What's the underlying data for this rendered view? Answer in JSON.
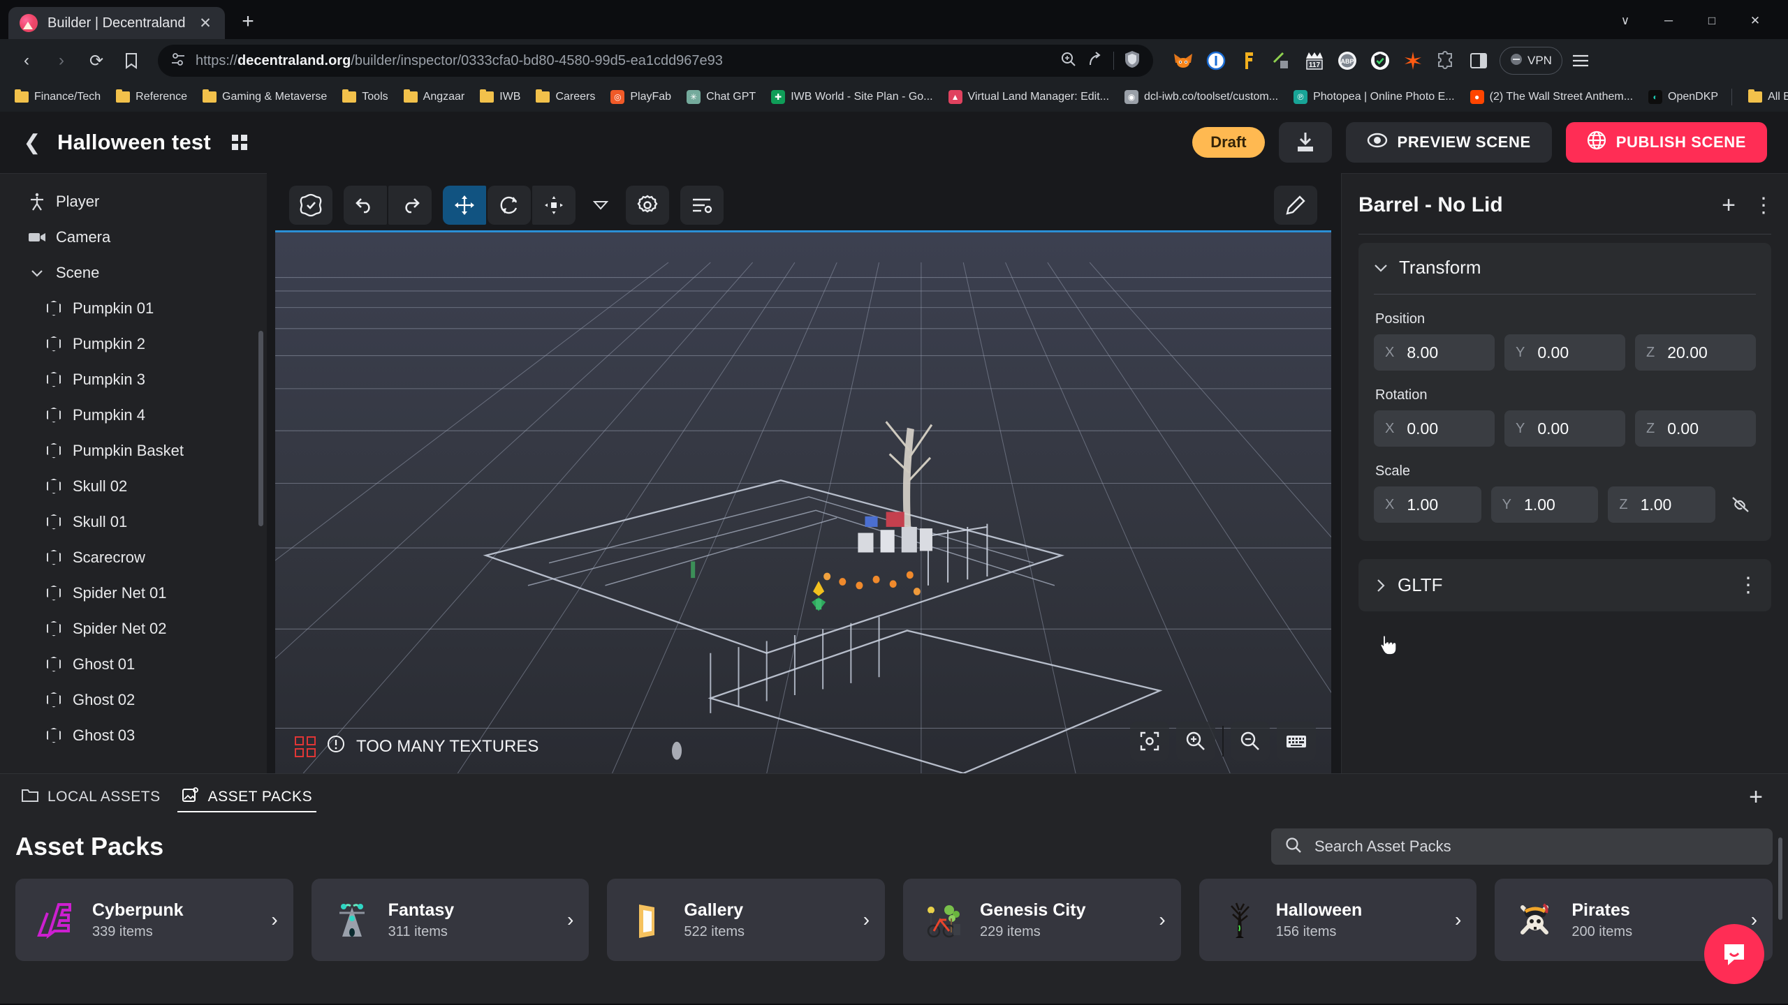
{
  "browser": {
    "tab": {
      "title": "Builder | Decentraland",
      "favicon": "decentraland-favicon",
      "close": "✕"
    },
    "newtab_label": "+",
    "window_controls": [
      "∨",
      "─",
      "□",
      "✕"
    ],
    "nav": {
      "back": "‹",
      "forward": "›",
      "reload": "⟳",
      "bookmark_star": "bookmark-icon"
    },
    "url": {
      "scheme": "https://",
      "domain": "decentraland.org",
      "path": "/builder/inspector/0333cfa0-bd80-4580-99d5-ea1cdd967e93",
      "full": "https://decentraland.org/builder/inspector/0333cfa0-bd80-4580-99d5-ea1cdd967e93"
    },
    "vpn_label": "VPN",
    "extensions": [
      {
        "name": "metamask-extension",
        "glyph": "🦊"
      },
      {
        "name": "1password-extension",
        "glyph": "①"
      },
      {
        "name": "yellow-tool-extension",
        "glyph": "🔨"
      },
      {
        "name": "eyedropper-extension",
        "glyph": "✒"
      },
      {
        "name": "badge-117-extension",
        "glyph": "117"
      },
      {
        "name": "adblock-plus-extension",
        "glyph": "ABP"
      },
      {
        "name": "shield-extension",
        "glyph": "✓"
      },
      {
        "name": "star-extension",
        "glyph": "✳"
      },
      {
        "name": "puzzle-extensions-icon",
        "glyph": "❖"
      },
      {
        "name": "side-panel-icon",
        "glyph": "◯"
      },
      {
        "name": "browser-menu-icon",
        "glyph": "☰"
      }
    ],
    "bookmarks": [
      {
        "label": "Finance/Tech",
        "type": "folder"
      },
      {
        "label": "Reference",
        "type": "folder"
      },
      {
        "label": "Gaming & Metaverse",
        "type": "folder"
      },
      {
        "label": "Tools",
        "type": "folder"
      },
      {
        "label": "Angzaar",
        "type": "folder"
      },
      {
        "label": "IWB",
        "type": "folder"
      },
      {
        "label": "Careers",
        "type": "folder"
      },
      {
        "label": "PlayFab",
        "type": "site",
        "color": "#f05a28",
        "glyph": "◎"
      },
      {
        "label": "Chat GPT",
        "type": "site",
        "color": "#74aa9c",
        "glyph": "✳"
      },
      {
        "label": "IWB World - Site Plan - Go...",
        "type": "site",
        "color": "#0f9d58",
        "glyph": "✚"
      },
      {
        "label": "Virtual Land Manager: Edit...",
        "type": "site",
        "color": "#e0425f",
        "glyph": "▲"
      },
      {
        "label": "dcl-iwb.co/toolset/custom...",
        "type": "site",
        "color": "#9aa0a8",
        "glyph": "◉"
      },
      {
        "label": "Photopea | Online Photo E...",
        "type": "site",
        "color": "#18a497",
        "glyph": "℗"
      },
      {
        "label": "(2) The Wall Street Anthem...",
        "type": "site",
        "color": "#ff4500",
        "glyph": "●"
      },
      {
        "label": "OpenDKP",
        "type": "site",
        "color": "#1cc8b0",
        "glyph": "◐"
      }
    ],
    "all_bookmarks_label": "All Bookmarks"
  },
  "app_header": {
    "back_icon": "back-chevron-icon",
    "scene_title": "Halloween test",
    "grid_icon": "grid-view-icon",
    "status_badge": "Draft",
    "download_icon": "download-icon",
    "preview_label": "PREVIEW SCENE",
    "publish_label": "PUBLISH SCENE",
    "accent_publish": "#ff2d55",
    "accent_draft": "#ffb951"
  },
  "sidebar": {
    "items": [
      {
        "label": "Player",
        "icon": "player-icon",
        "level": 0
      },
      {
        "label": "Camera",
        "icon": "camera-icon",
        "level": 0
      },
      {
        "label": "Scene",
        "icon": "chevron-down-icon",
        "level": 0
      },
      {
        "label": "Pumpkin 01",
        "icon": "entity-hex-icon",
        "level": 1
      },
      {
        "label": "Pumpkin 2",
        "icon": "entity-hex-icon",
        "level": 1
      },
      {
        "label": "Pumpkin 3",
        "icon": "entity-hex-icon",
        "level": 1
      },
      {
        "label": "Pumpkin 4",
        "icon": "entity-hex-icon",
        "level": 1
      },
      {
        "label": "Pumpkin Basket",
        "icon": "entity-hex-icon",
        "level": 1
      },
      {
        "label": "Skull 02",
        "icon": "entity-hex-icon",
        "level": 1
      },
      {
        "label": "Skull 01",
        "icon": "entity-hex-icon",
        "level": 1
      },
      {
        "label": "Scarecrow",
        "icon": "entity-hex-icon",
        "level": 1
      },
      {
        "label": "Spider Net 01",
        "icon": "entity-hex-icon",
        "level": 1
      },
      {
        "label": "Spider Net 02",
        "icon": "entity-hex-icon",
        "level": 1
      },
      {
        "label": "Ghost 01",
        "icon": "entity-hex-icon",
        "level": 1
      },
      {
        "label": "Ghost 02",
        "icon": "entity-hex-icon",
        "level": 1
      },
      {
        "label": "Ghost 03",
        "icon": "entity-hex-icon",
        "level": 1
      }
    ]
  },
  "viewport": {
    "toolbar": [
      {
        "name": "scene-validate-icon",
        "active": false
      },
      {
        "name": "undo-icon",
        "active": false
      },
      {
        "name": "redo-icon",
        "active": false
      },
      {
        "name": "move-tool-icon",
        "active": true
      },
      {
        "name": "rotate-tool-icon",
        "active": false
      },
      {
        "name": "scale-tool-icon",
        "active": false
      },
      {
        "name": "tool-dropdown-caret-icon",
        "active": false
      },
      {
        "name": "settings-gear-icon",
        "active": false
      },
      {
        "name": "preferences-sliders-icon",
        "active": false
      },
      {
        "name": "edit-pencil-icon",
        "active": false
      }
    ],
    "warning": "TOO MANY TEXTURES",
    "warning_color": "#e03636",
    "controls": [
      {
        "name": "focus-camera-icon"
      },
      {
        "name": "zoom-in-icon"
      },
      {
        "name": "zoom-out-icon"
      },
      {
        "name": "keyboard-shortcuts-icon"
      }
    ]
  },
  "inspector": {
    "title": "Barrel - No Lid",
    "add_component_label": "+",
    "more_menu_label": "⋮",
    "components": [
      {
        "name": "Transform",
        "expanded": true,
        "fields": [
          {
            "label": "Position",
            "axes": [
              {
                "axis": "X",
                "value": "8.00"
              },
              {
                "axis": "Y",
                "value": "0.00"
              },
              {
                "axis": "Z",
                "value": "20.00"
              }
            ]
          },
          {
            "label": "Rotation",
            "axes": [
              {
                "axis": "X",
                "value": "0.00"
              },
              {
                "axis": "Y",
                "value": "0.00"
              },
              {
                "axis": "Z",
                "value": "0.00"
              }
            ]
          },
          {
            "label": "Scale",
            "axes": [
              {
                "axis": "X",
                "value": "1.00"
              },
              {
                "axis": "Y",
                "value": "1.00"
              },
              {
                "axis": "Z",
                "value": "1.00"
              }
            ],
            "link_icon": "unlink-scale-icon"
          }
        ]
      },
      {
        "name": "GLTF",
        "expanded": false,
        "more_menu_label": "⋮"
      }
    ]
  },
  "assets": {
    "tabs": [
      {
        "label": "LOCAL ASSETS",
        "icon": "folder-icon",
        "active": false
      },
      {
        "label": "ASSET PACKS",
        "icon": "asset-pack-icon",
        "active": true
      }
    ],
    "add_label": "+",
    "heading": "Asset Packs",
    "search_placeholder": "Search Asset Packs",
    "search_value": "",
    "search_icon": "search-icon",
    "packs": [
      {
        "name": "Cyberpunk",
        "count": "339 items",
        "thumb": "cyberpunk-logo",
        "arrow": "›"
      },
      {
        "name": "Fantasy",
        "count": "311 items",
        "thumb": "fantasy-figure",
        "arrow": "›"
      },
      {
        "name": "Gallery",
        "count": "522 items",
        "thumb": "gallery-frame",
        "arrow": "›"
      },
      {
        "name": "Genesis City",
        "count": "229 items",
        "thumb": "genesis-bicycle",
        "arrow": "›"
      },
      {
        "name": "Halloween",
        "count": "156 items",
        "thumb": "halloween-tree",
        "arrow": "›"
      },
      {
        "name": "Pirates",
        "count": "200 items",
        "thumb": "pirates-skull",
        "arrow": "›"
      }
    ],
    "chat_button": "chat-bubble-icon",
    "chat_color": "#ff2d55"
  }
}
